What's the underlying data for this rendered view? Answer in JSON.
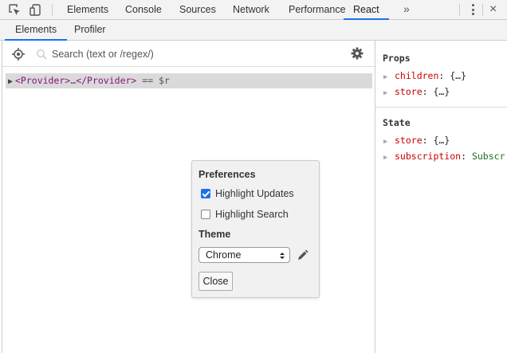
{
  "toolbar": {
    "tabs": [
      "Elements",
      "Console",
      "Sources",
      "Network",
      "Performance",
      "React"
    ],
    "active_tab": "React",
    "overflow": "»"
  },
  "subtabs": [
    "Elements",
    "Profiler"
  ],
  "search": {
    "placeholder": "Search (text or /regex/)",
    "value": ""
  },
  "tree": {
    "open_tag": "<Provider>",
    "ellipsis": "…",
    "close_tag": "</Provider>",
    "suffix": " == $r"
  },
  "preferences": {
    "title": "Preferences",
    "highlight_updates": {
      "label": "Highlight Updates",
      "checked": true
    },
    "highlight_search": {
      "label": "Highlight Search",
      "checked": false
    },
    "theme_title": "Theme",
    "theme_value": "Chrome",
    "close_label": "Close"
  },
  "props": {
    "title": "Props",
    "items": [
      {
        "key": "children",
        "value": "{…}"
      },
      {
        "key": "store",
        "value": "{…}"
      }
    ]
  },
  "state": {
    "title": "State",
    "items": [
      {
        "key": "store",
        "value": "{…}"
      },
      {
        "key": "subscription",
        "value": "Subscr"
      }
    ]
  },
  "colors": {
    "accent": "#1a73e8",
    "tag": "#881280",
    "prop_key": "#c80000",
    "prop_value_type": "#236e25"
  }
}
